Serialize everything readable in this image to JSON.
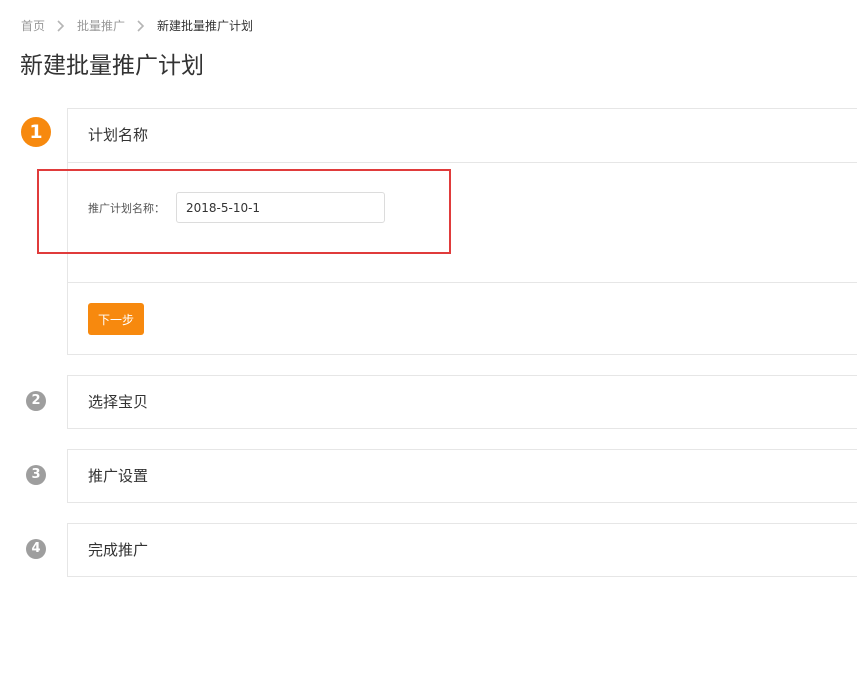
{
  "breadcrumb": {
    "items": [
      "首页",
      "批量推广",
      "新建批量推广计划"
    ]
  },
  "page": {
    "title": "新建批量推广计划"
  },
  "steps": [
    {
      "number": "1",
      "title": "计划名称"
    },
    {
      "number": "2",
      "title": "选择宝贝"
    },
    {
      "number": "3",
      "title": "推广设置"
    },
    {
      "number": "4",
      "title": "完成推广"
    }
  ],
  "plan_form": {
    "label": "推广计划名称：",
    "value": "2018-5-10-1",
    "next_label": "下一步"
  },
  "colors": {
    "accent": "#f7890e",
    "inactive_step": "#9e9e9e",
    "highlight": "#e03b3b",
    "border": "#e6e6e6"
  }
}
